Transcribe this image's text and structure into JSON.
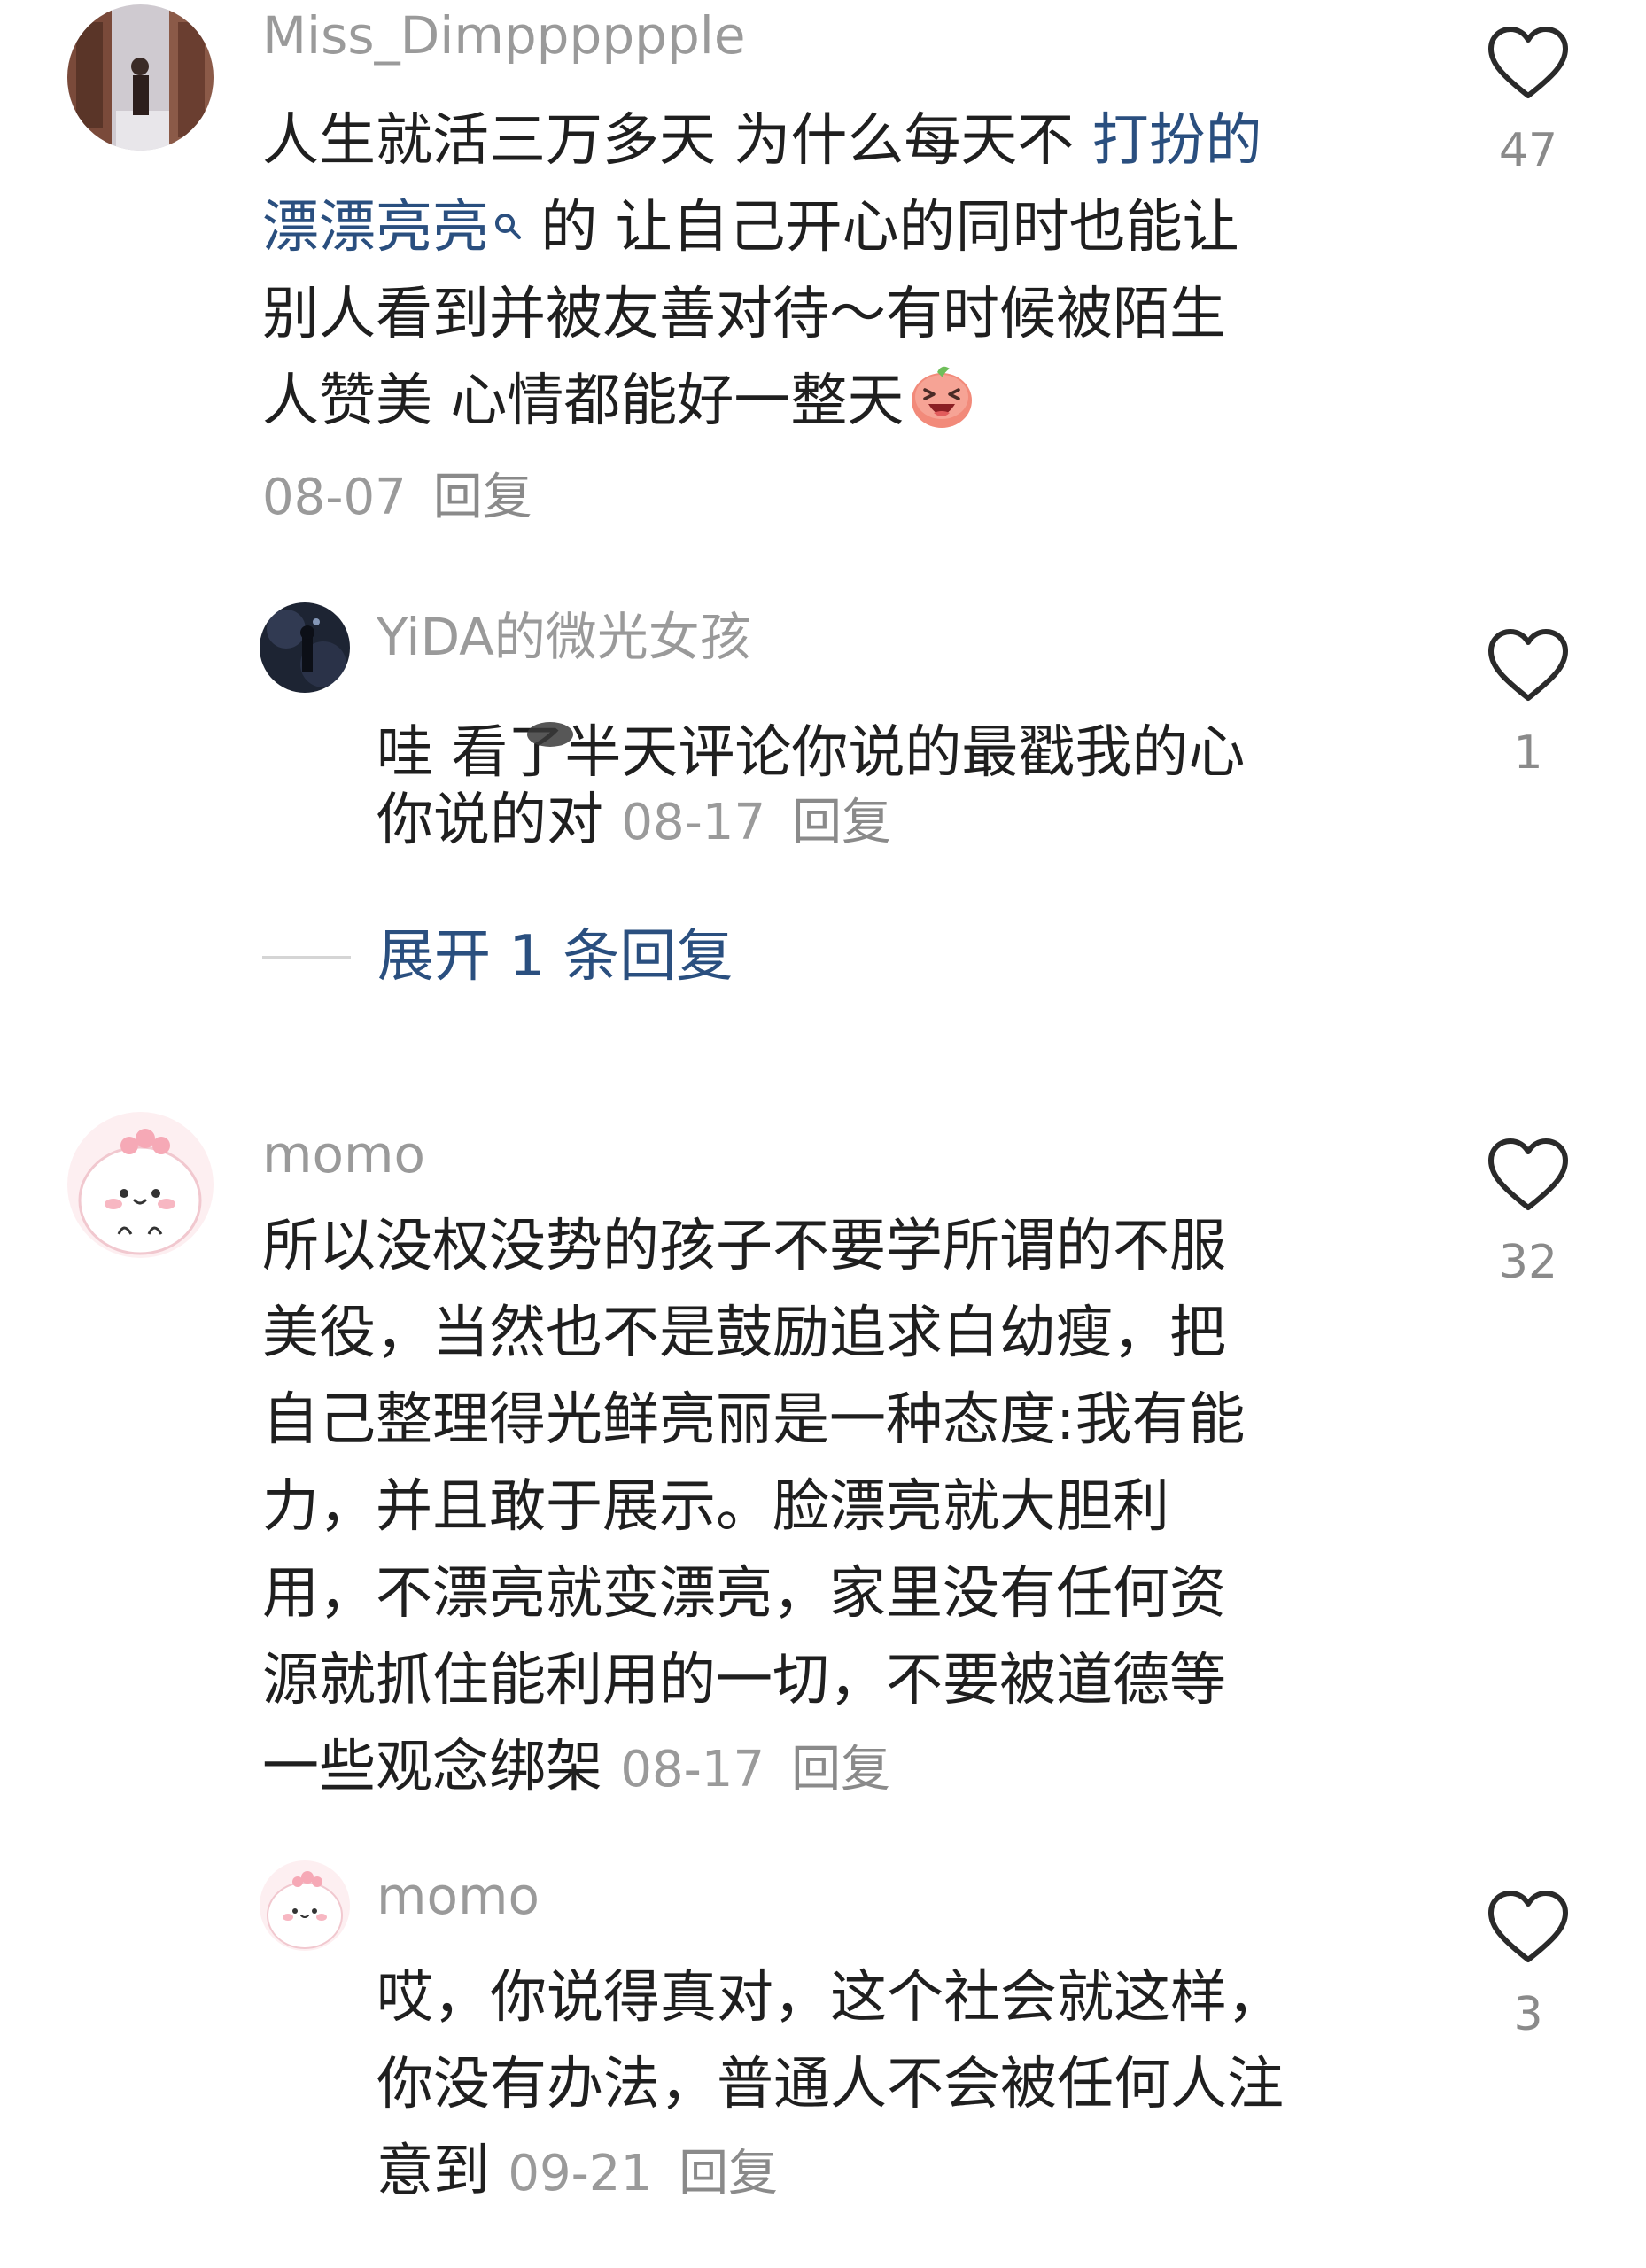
{
  "comments": [
    {
      "username": "Miss_Dimpppppple",
      "content_lines": [
        [
          "人生就活三万多天 为什么每天不 ",
          "打扮的"
        ],
        [
          "漂漂亮亮",
          " 的 让自己开心的同时也能让"
        ],
        [
          "别人看到并被友善对待～有时候被陌生"
        ],
        [
          "人赞美 心情都能好一整天"
        ]
      ],
      "date": "08-07",
      "reply_label": "回复",
      "like_count": "47",
      "replies": [
        {
          "username": "YiDA的微光女孩",
          "content_lines": [
            [
              "哇 看了",
              "半天评论你说的最戳我的心"
            ],
            [
              "你说的对"
            ]
          ],
          "date": "08-17",
          "reply_label": "回复",
          "like_count": "1"
        }
      ],
      "expand_label": "展开 1 条回复"
    },
    {
      "username": "momo",
      "content_lines": [
        [
          "所以没权没势的孩子不要学所谓的不服"
        ],
        [
          "美役，当然也不是鼓励追求白幼瘦，把"
        ],
        [
          "自己整理得光鲜亮丽是一种态度:我有能"
        ],
        [
          "力，并且敢于展示。脸漂亮就大胆利"
        ],
        [
          "用，不漂亮就变漂亮，家里没有任何资"
        ],
        [
          "源就抓住能利用的一切，不要被道德等"
        ],
        [
          "一些观念绑架"
        ]
      ],
      "date": "08-17",
      "reply_label": "回复",
      "like_count": "32",
      "replies": [
        {
          "username": "momo",
          "content_lines": [
            [
              "哎，你说得真对，这个社会就这样，"
            ],
            [
              "你没有办法，普通人不会被任何人注"
            ],
            [
              "意到"
            ]
          ],
          "date": "09-21",
          "reply_label": "回复",
          "like_count": "3"
        }
      ]
    }
  ],
  "icons": {
    "like": "heart-outline-icon",
    "search": "search-icon",
    "emoji": "laughing-face-emoji"
  },
  "colors": {
    "link": "#2a4f7f",
    "meta": "#9a9a9a",
    "text": "#1f1f1f"
  }
}
